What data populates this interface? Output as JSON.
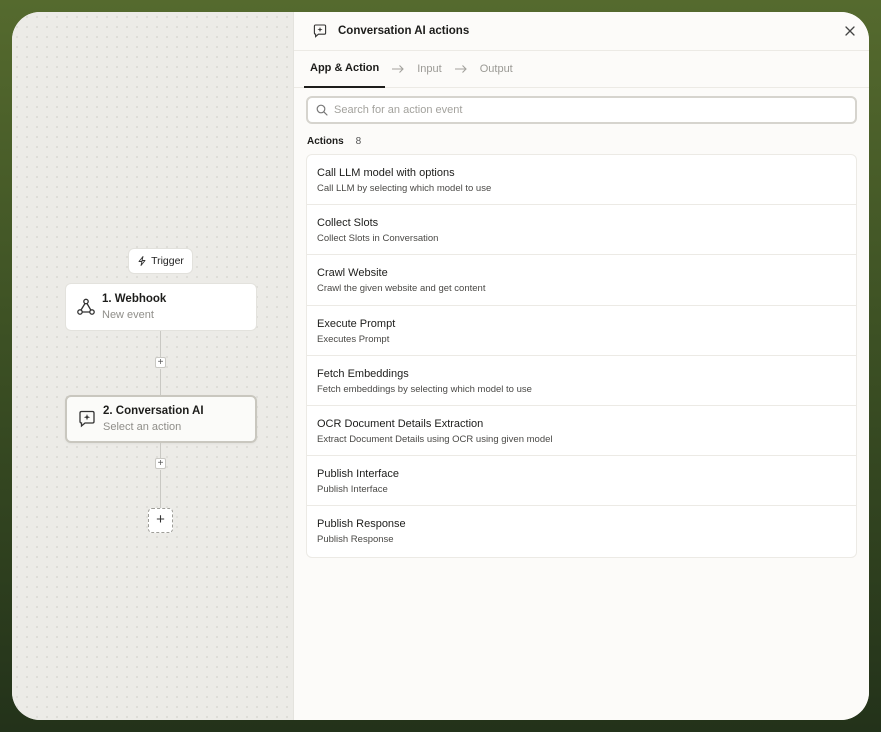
{
  "canvas": {
    "trigger_label": "Trigger",
    "nodes": [
      {
        "title": "1. Webhook",
        "subtitle": "New event"
      },
      {
        "title": "2. Conversation AI",
        "subtitle": "Select an action"
      }
    ],
    "add_step_symbol": "+"
  },
  "panel": {
    "title": "Conversation AI actions",
    "tabs": [
      "App & Action",
      "Input",
      "Output"
    ],
    "search_placeholder": "Search for an action event",
    "actions_label": "Actions",
    "actions_count": "8",
    "actions": [
      {
        "title": "Call LLM model with options",
        "description": "Call LLM by selecting which model to use"
      },
      {
        "title": "Collect Slots",
        "description": "Collect Slots in Conversation"
      },
      {
        "title": "Crawl Website",
        "description": "Crawl the given website and get content"
      },
      {
        "title": "Execute Prompt",
        "description": "Executes Prompt"
      },
      {
        "title": "Fetch Embeddings",
        "description": "Fetch embeddings by selecting which model to use"
      },
      {
        "title": "OCR Document Details Extraction",
        "description": "Extract Document Details using OCR using given model"
      },
      {
        "title": "Publish Interface",
        "description": "Publish Interface"
      },
      {
        "title": "Publish Response",
        "description": "Publish Response"
      }
    ]
  },
  "colors": {
    "background_top": "#556a2e",
    "background_bottom": "#23321a",
    "panel": "#fcfbf9",
    "canvas": "#ecebe7"
  },
  "icons": [
    "bolt-icon",
    "webhook-icon",
    "ai-chat-icon",
    "close-icon",
    "arrow-right-icon",
    "search-icon"
  ]
}
